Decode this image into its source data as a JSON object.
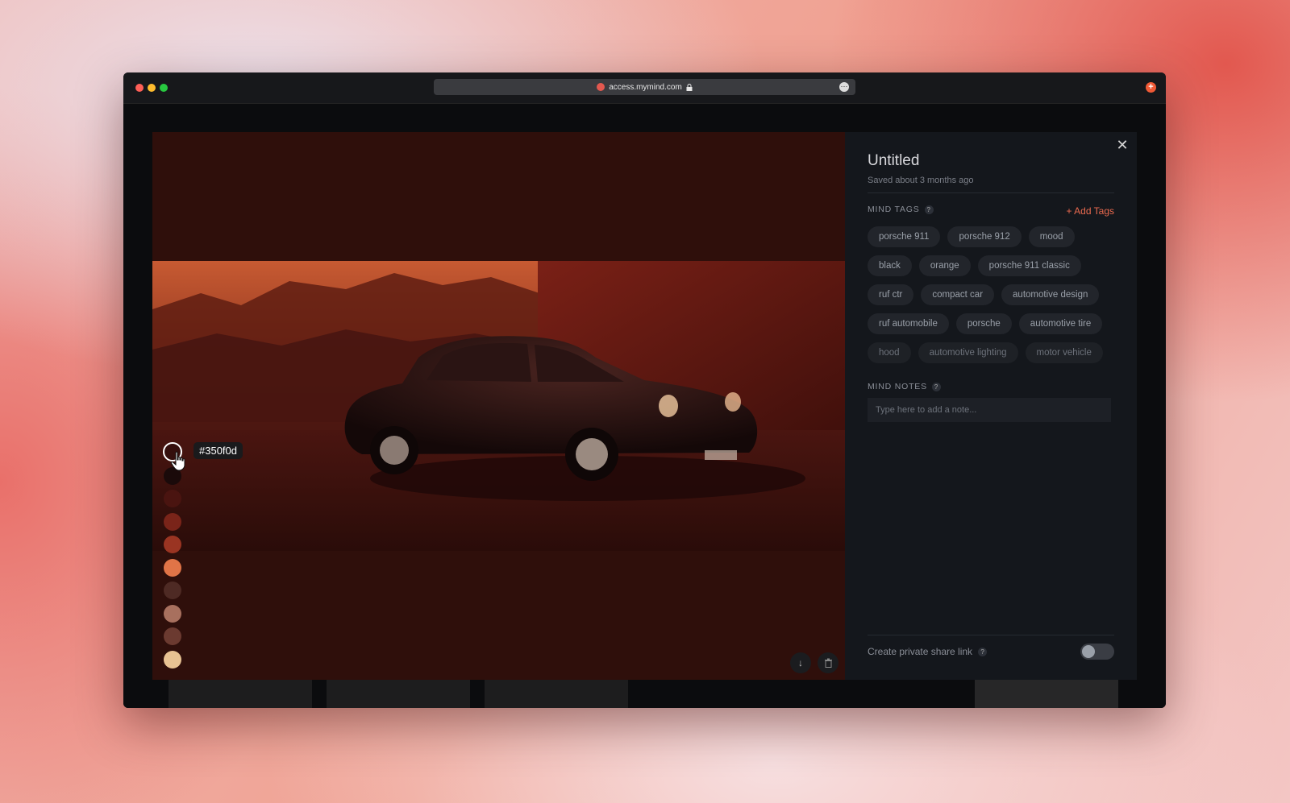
{
  "browser": {
    "url": "access.mymind.com"
  },
  "card": {
    "title": "Untitled",
    "saved_text": "Saved about 3 months ago"
  },
  "tags_section": {
    "label": "MIND TAGS",
    "help": "?",
    "add_label": "+ Add Tags",
    "tags": [
      "porsche 911",
      "porsche 912",
      "mood",
      "black",
      "orange",
      "porsche 911 classic",
      "ruf ctr",
      "compact car",
      "automotive design",
      "ruf automobile",
      "porsche",
      "automotive tire",
      "hood",
      "automotive lighting",
      "motor vehicle"
    ]
  },
  "notes_section": {
    "label": "MIND NOTES",
    "help": "?",
    "placeholder": "Type here to add a note..."
  },
  "share": {
    "label": "Create private share link",
    "help": "?",
    "enabled": false
  },
  "palette": {
    "active_hex": "#350f0d",
    "swatches": [
      "#350f0d",
      "#1a0a0a",
      "#4a1410",
      "#7a2419",
      "#9a3422",
      "#e07447",
      "#4e2a24",
      "#a8705e",
      "#6b3a30",
      "#e8c393"
    ]
  },
  "icons": {
    "close": "close-icon",
    "download": "download-icon",
    "delete": "trash-icon"
  }
}
